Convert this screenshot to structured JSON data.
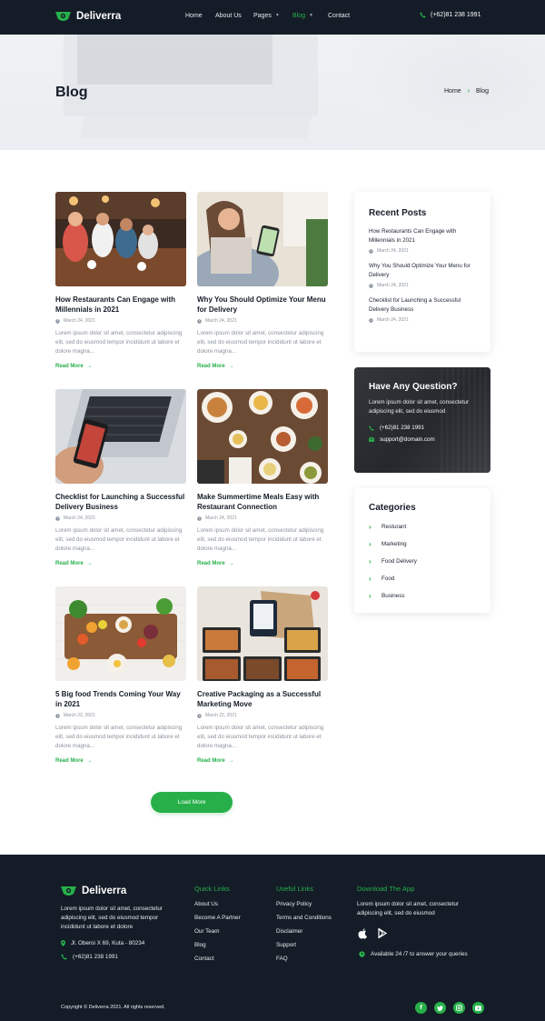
{
  "brand": {
    "name": "Deliverra",
    "accent": "#27b04a",
    "dark": "#141c27"
  },
  "nav": {
    "links": [
      "Home",
      "About Us",
      "Pages",
      "Blog",
      "Contact"
    ],
    "active": "Blog",
    "phone": "(+62)81 238 1991"
  },
  "hero": {
    "title": "Blog",
    "breadcrumb": [
      "Home",
      "Blog"
    ]
  },
  "posts": [
    {
      "title": "How Restaurants Can Engage with Millennials in 2021",
      "date": "March 24, 2021",
      "excerpt": "Lorem ipsum dolor sit amet, consectetur adipiscing elit, sed do eiusmod tempor incididunt ut labore et dolore magna...",
      "read_more": "Read More",
      "image": "restaurant-people-photo"
    },
    {
      "title": "Why You Should Optimize Your Menu for Delivery",
      "date": "March 24, 2021",
      "excerpt": "Lorem ipsum dolor sit amet, consectetur adipiscing elit, sed do eiusmod tempor incididunt ut labore et dolore magna...",
      "read_more": "Read More",
      "image": "woman-phone-photo"
    },
    {
      "title": "Checklist for Launching a Successful Delivery Business",
      "date": "March 24, 2021",
      "excerpt": "Lorem ipsum dolor sit amet, consectetur adipiscing elit, sed do eiusmod tempor incididunt ut labore et dolore magna...",
      "read_more": "Read More",
      "image": "phone-laptop-photo"
    },
    {
      "title": "Make Summertime Meals Easy with Restaurant Connection",
      "date": "March 24, 2021",
      "excerpt": "Lorem ipsum dolor sit amet, consectetur adipiscing elit, sed do eiusmod tempor incididunt ut labore et dolore magna...",
      "read_more": "Read More",
      "image": "table-dishes-photo"
    },
    {
      "title": "5 Big food Trends Coming Your Way in 2021",
      "date": "March 22, 2021",
      "excerpt": "Lorem ipsum dolor sit amet, consectetur adipiscing elit, sed do eiusmod tempor incididunt ut labore et dolore magna...",
      "read_more": "Read More",
      "image": "fruit-vegetable-photo"
    },
    {
      "title": "Creative Packaging as a Successful Marketing Move",
      "date": "March 22, 2021",
      "excerpt": "Lorem ipsum dolor sit amet, consectetur adipiscing elit, sed do eiusmod tempor incididunt ut labore et dolore magna...",
      "read_more": "Read More",
      "image": "packaging-photo"
    }
  ],
  "load_more": "Load More",
  "sidebar": {
    "recent": {
      "title": "Recent Posts",
      "items": [
        {
          "title": "How Restaurants Can Engage with Millennials in 2021",
          "date": "March 24, 2021"
        },
        {
          "title": "Why You Should Optimize Your Menu for Delivery",
          "date": "March 24, 2021"
        },
        {
          "title": "Checklist for Launching a Successful Delivery Business",
          "date": "March 24, 2021"
        }
      ]
    },
    "question": {
      "title": "Have Any Question?",
      "text": "Lorem ipsum dolor sit amet, consectetur adipiscing elit, sed do eiusmod",
      "phone": "(+62)81 238 1991",
      "email": "support@domain.com"
    },
    "categories": {
      "title": "Categories",
      "items": [
        "Resturant",
        "Marketing",
        "Food Delivery",
        "Food",
        "Business"
      ]
    }
  },
  "footer": {
    "brand": "Deliverra",
    "about": "Lorem ipsum dolor sit amet, consectetur adipiscing elit, sed do eiusmod tempor incididunt ut labore et dolore",
    "address": "Jl. Oberoi X 69, Kuta - 80234",
    "phone": "(+62)81 238 1991",
    "quick_links": {
      "title": "Quick Links",
      "items": [
        "About Us",
        "Become A Partner",
        "Our Team",
        "Blog",
        "Contact"
      ]
    },
    "useful_links": {
      "title": "Useful Links",
      "items": [
        "Privacy Policy",
        "Terms and Conditions",
        "Disclaimer",
        "Support",
        "FAQ"
      ]
    },
    "download": {
      "title": "Download The App",
      "text": "Lorem ipsum dolor sit amet, consectetur adipiscing elit, sed do eiusmod",
      "availability": "Available 24 /7 to answer your queries"
    },
    "copyright": "Copyright © Deliverra 2021. All rights reserved.",
    "social": [
      "facebook",
      "twitter",
      "instagram",
      "youtube"
    ]
  }
}
